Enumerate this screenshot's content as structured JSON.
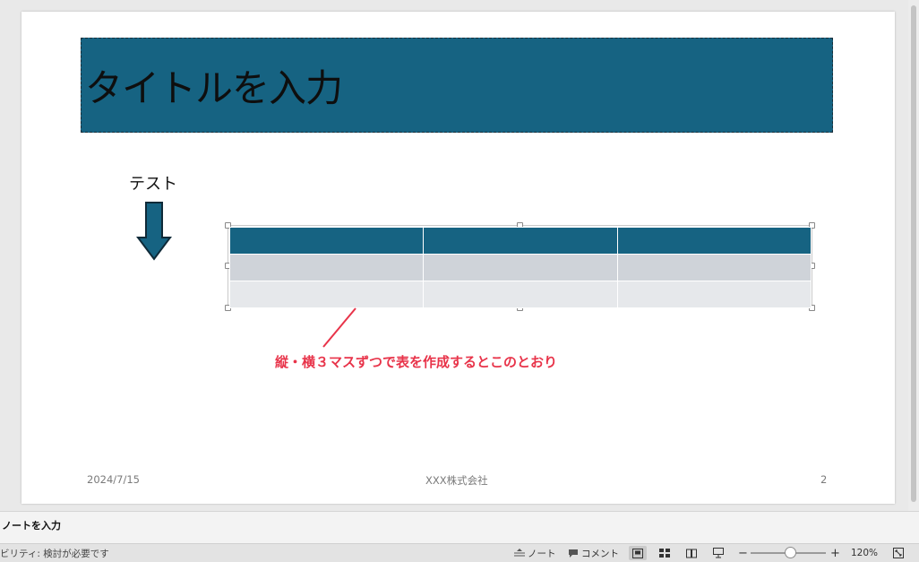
{
  "slide": {
    "title": "タイトルを入力",
    "test_label": "テスト",
    "callout": "縦・横３マスずつで表を作成するとこのとおり",
    "footer": {
      "date": "2024/7/15",
      "company": "XXX株式会社",
      "page_number": "2"
    }
  },
  "table": {
    "rows": 3,
    "columns": 3
  },
  "colors": {
    "title_fill": "#166382",
    "header_row": "#166382",
    "row_band_1": "#cfd3d9",
    "row_band_2": "#e6e8eb",
    "callout": "#e8344a"
  },
  "notes": {
    "placeholder": "ノートを入力"
  },
  "status_bar": {
    "accessibility": "ビリティ: 検討が必要です",
    "notes_label": "ノート",
    "comments_label": "コメント",
    "zoom_minus": "−",
    "zoom_plus": "+",
    "zoom": "120%"
  }
}
